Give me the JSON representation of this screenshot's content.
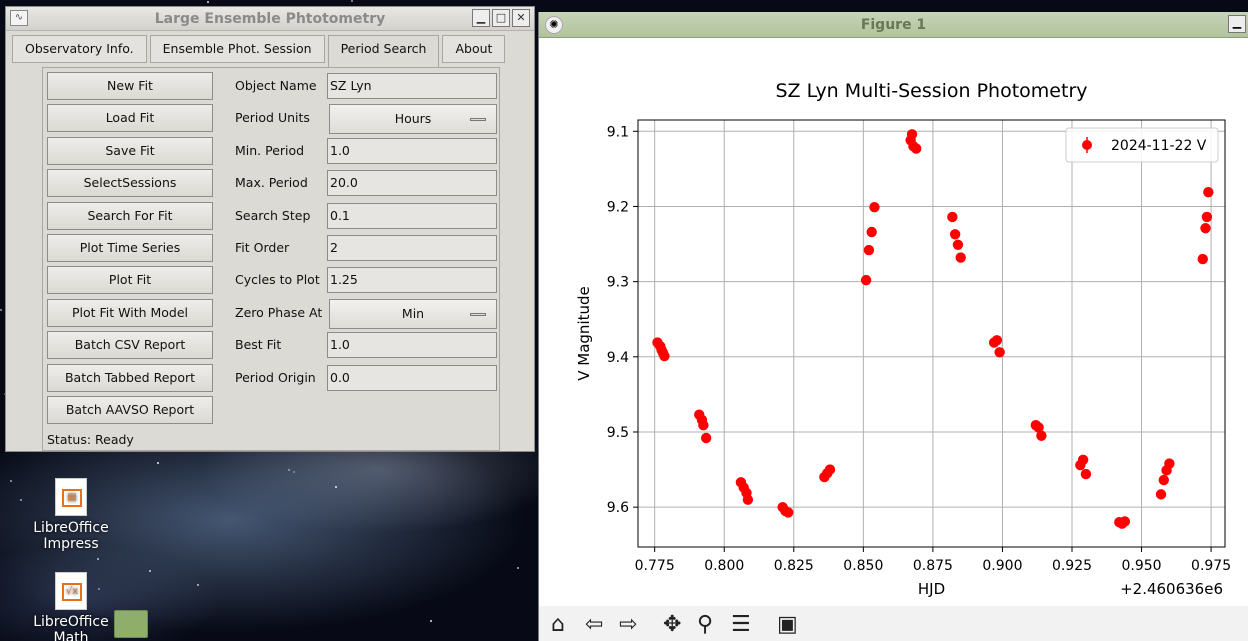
{
  "app_window": {
    "title": "Large Ensemble Phtotometry",
    "tabs": [
      "Observatory Info.",
      "Ensemble Phot. Session",
      "Period Search",
      "About"
    ],
    "active_tab": "Period Search",
    "buttons": [
      "New Fit",
      "Load Fit",
      "Save Fit",
      "SelectSessions",
      "Search For Fit",
      "Plot Time Series",
      "Plot Fit",
      "Plot Fit With Model",
      "Batch CSV Report",
      "Batch Tabbed Report",
      "Batch AAVSO Report"
    ],
    "fields": [
      {
        "label": "Object Name",
        "value": "SZ Lyn",
        "kind": "text"
      },
      {
        "label": "Period Units",
        "value": "Hours",
        "kind": "combo"
      },
      {
        "label": "Min. Period",
        "value": "1.0",
        "kind": "text"
      },
      {
        "label": "Max. Period",
        "value": "20.0",
        "kind": "text"
      },
      {
        "label": "Search Step",
        "value": "0.1",
        "kind": "text"
      },
      {
        "label": "Fit Order",
        "value": "2",
        "kind": "text"
      },
      {
        "label": "Cycles to Plot",
        "value": "1.25",
        "kind": "text"
      },
      {
        "label": "Zero Phase At",
        "value": "Min",
        "kind": "combo"
      },
      {
        "label": "Best Fit",
        "value": "1.0",
        "kind": "text"
      },
      {
        "label": "Period Origin",
        "value": "0.0",
        "kind": "text"
      }
    ],
    "status": "Status: Ready"
  },
  "desktop_icons": [
    {
      "line1": "LibreOffice",
      "line2": "Impress",
      "icon": "impress-icon"
    },
    {
      "line1": "LibreOffice",
      "line2": "Math",
      "icon": "math-icon"
    }
  ],
  "figure_window": {
    "title": "Figure 1"
  },
  "chart_data": {
    "type": "scatter",
    "title": "SZ Lyn Multi-Session Photometry",
    "xlabel": "HJD",
    "ylabel": "V Magnitude",
    "x_offset_label": "+2.460636e6",
    "x_ticks": [
      "0.775",
      "0.800",
      "0.825",
      "0.850",
      "0.875",
      "0.900",
      "0.925",
      "0.950",
      "0.975"
    ],
    "y_ticks": [
      "9.1",
      "9.2",
      "9.3",
      "9.4",
      "9.5",
      "9.6"
    ],
    "xlim": [
      2460636.769,
      2460636.98
    ],
    "ylim": [
      9.653,
      9.085
    ],
    "y_inverted": true,
    "grid": true,
    "legend_loc": "upper right",
    "marker_color": "#ff0000",
    "series": [
      {
        "name": "2024-11-22 V",
        "x": [
          2460636.776,
          2460636.777,
          2460636.7775,
          2460636.778,
          2460636.7785,
          2460636.791,
          2460636.792,
          2460636.7925,
          2460636.7935,
          2460636.806,
          2460636.807,
          2460636.808,
          2460636.8085,
          2460636.821,
          2460636.822,
          2460636.823,
          2460636.836,
          2460636.837,
          2460636.838,
          2460636.851,
          2460636.852,
          2460636.853,
          2460636.854,
          2460636.867,
          2460636.8675,
          2460636.868,
          2460636.869,
          2460636.882,
          2460636.883,
          2460636.884,
          2460636.885,
          2460636.897,
          2460636.898,
          2460636.899,
          2460636.912,
          2460636.913,
          2460636.914,
          2460636.928,
          2460636.929,
          2460636.93,
          2460636.942,
          2460636.943,
          2460636.944,
          2460636.957,
          2460636.958,
          2460636.959,
          2460636.96,
          2460636.972,
          2460636.973,
          2460636.9735,
          2460636.974
        ],
        "y": [
          9.381,
          9.386,
          9.391,
          9.395,
          9.399,
          9.477,
          9.484,
          9.491,
          9.508,
          9.567,
          9.574,
          9.581,
          9.59,
          9.6,
          9.605,
          9.607,
          9.56,
          9.555,
          9.55,
          9.298,
          9.258,
          9.234,
          9.201,
          9.112,
          9.104,
          9.12,
          9.123,
          9.214,
          9.237,
          9.251,
          9.268,
          9.381,
          9.378,
          9.394,
          9.491,
          9.494,
          9.505,
          9.544,
          9.537,
          9.556,
          9.62,
          9.622,
          9.619,
          9.583,
          9.564,
          9.551,
          9.542,
          9.27,
          9.229,
          9.214,
          9.181
        ]
      }
    ]
  }
}
